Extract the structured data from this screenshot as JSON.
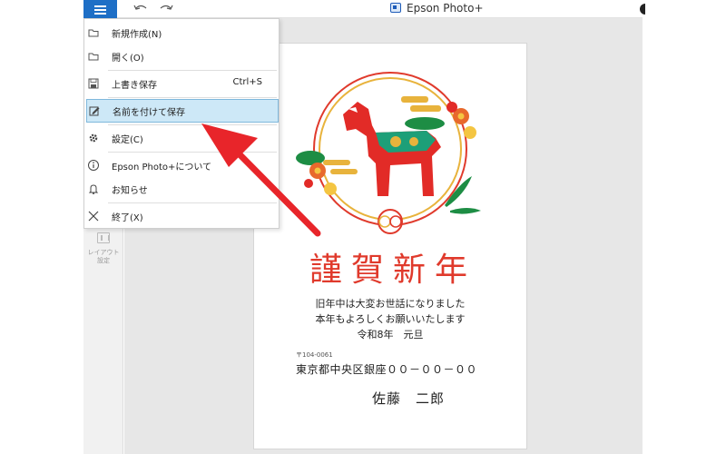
{
  "app": {
    "title": "Epson Photo+"
  },
  "menu": {
    "items": [
      {
        "label": "新規作成(N)",
        "shortcut": ""
      },
      {
        "label": "開く(O)",
        "shortcut": ""
      },
      {
        "label": "上書き保存",
        "shortcut": "Ctrl+S"
      },
      {
        "label": "名前を付けて保存",
        "shortcut": "",
        "selected": true
      },
      {
        "label": "設定(C)",
        "shortcut": ""
      },
      {
        "label": "Epson Photo+について",
        "shortcut": ""
      },
      {
        "label": "お知らせ",
        "shortcut": ""
      },
      {
        "label": "終了(X)",
        "shortcut": ""
      }
    ]
  },
  "sidebar": {
    "layout_tool_label": "レイアウト設定"
  },
  "card": {
    "title": "謹賀新年",
    "greeting": [
      "旧年中は大変お世話になりました",
      "本年もよろしくお願いいたします",
      "令和8年　元旦"
    ],
    "zip": "〒104-0061",
    "address": "東京都中央区銀座００－００－００",
    "name": "佐藤　二郎"
  },
  "colors": {
    "accent": "#1e6fc6",
    "highlight": "#cde8f7",
    "arrow": "#e8252a",
    "title_red": "#e03a2c"
  },
  "icons": {
    "menu": "hamburger-icon",
    "undo": "undo-icon",
    "redo": "redo-icon",
    "new": "folder-icon",
    "open": "folder-open-icon",
    "save": "save-icon",
    "save_as": "edit-icon",
    "settings": "gear-icon",
    "about": "info-icon",
    "notice": "bell-icon",
    "exit": "close-icon"
  }
}
